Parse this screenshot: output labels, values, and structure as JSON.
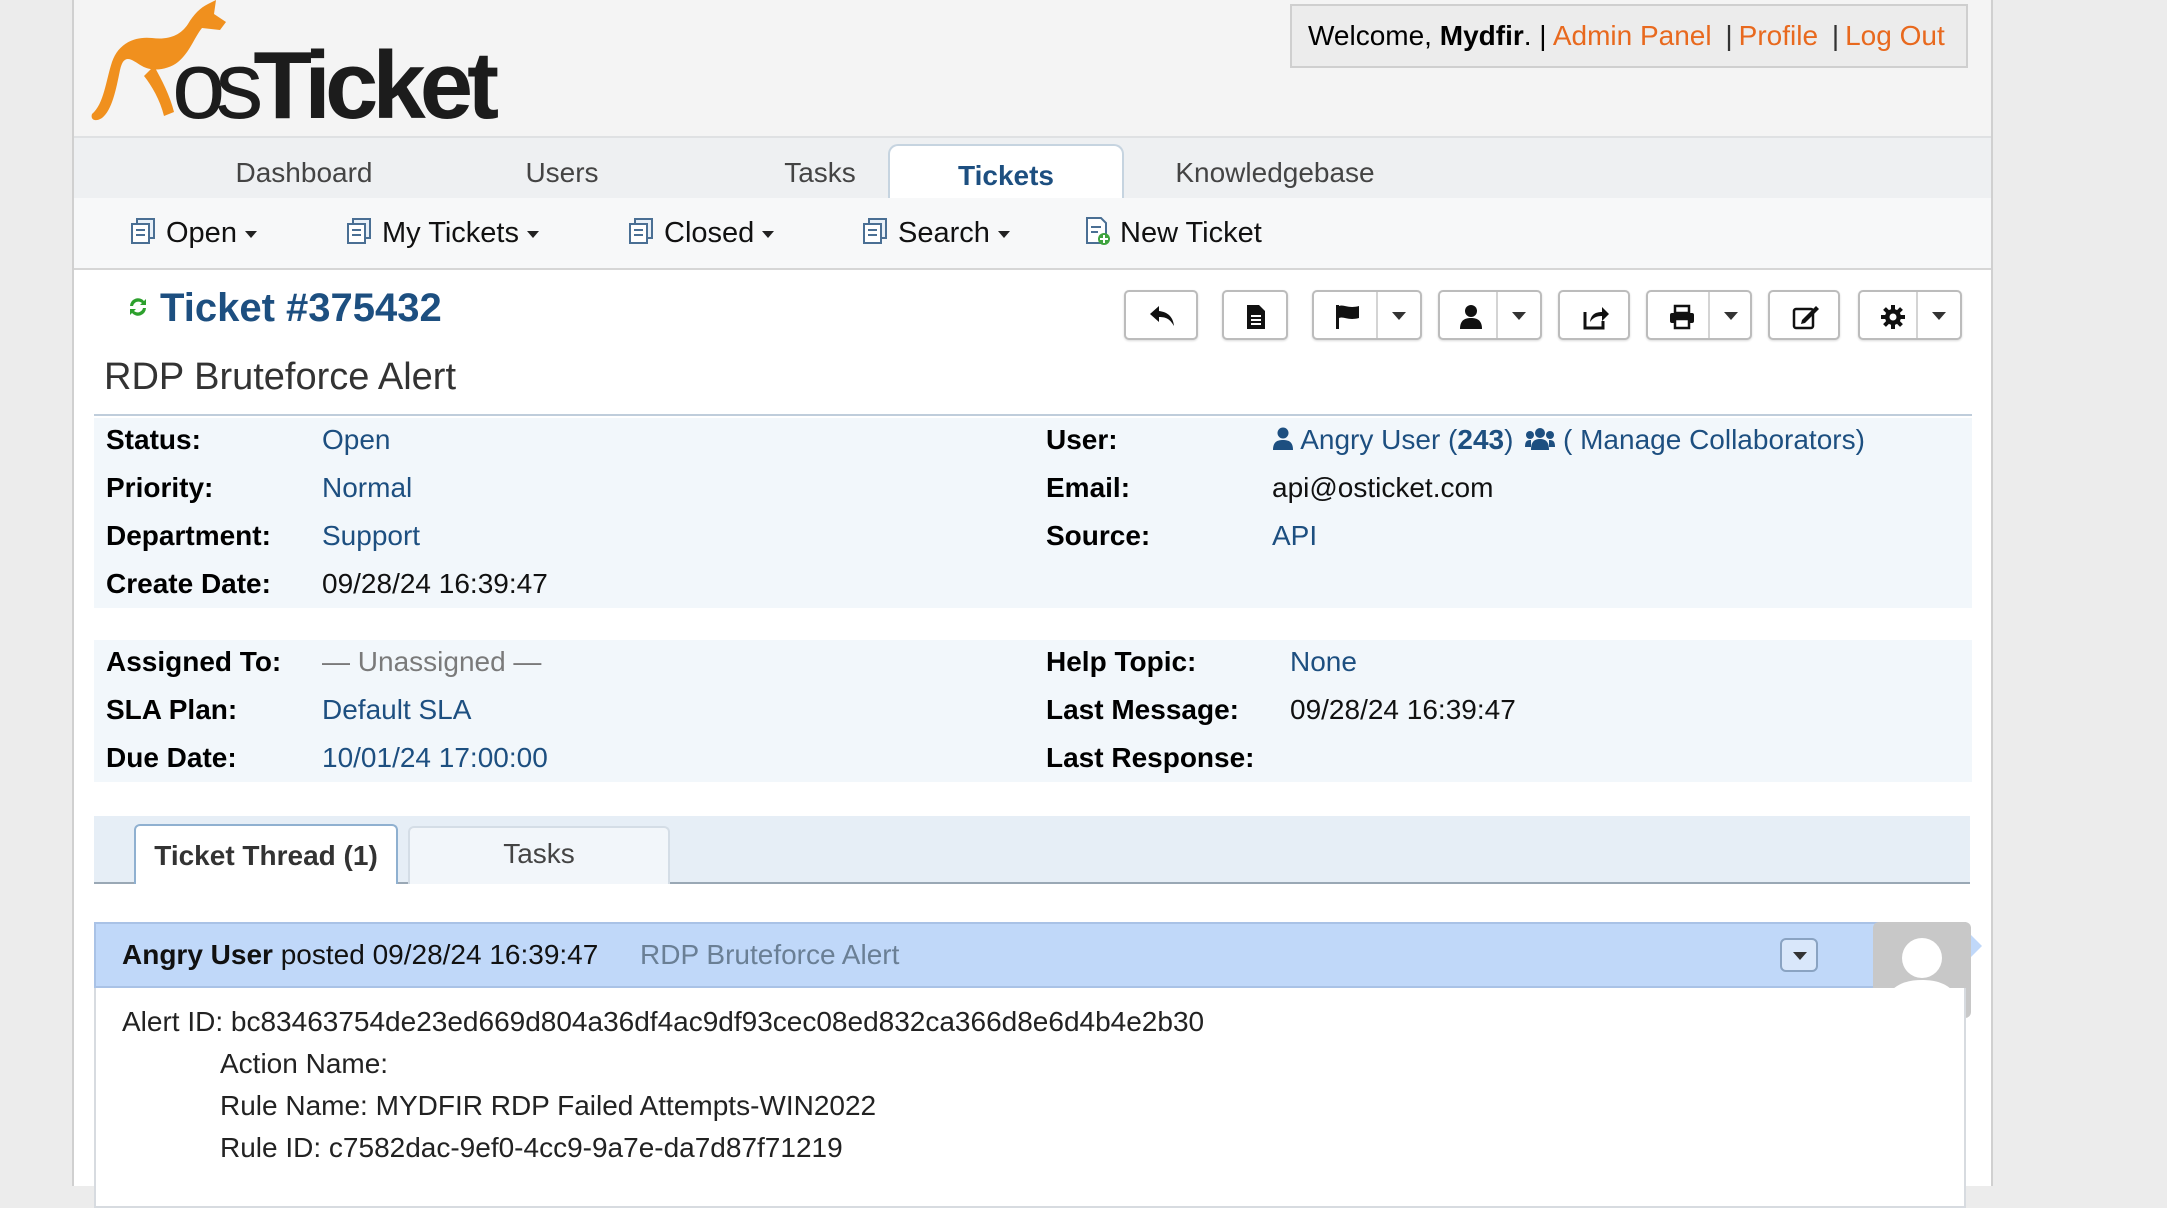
{
  "header": {
    "logo_text_os": "os",
    "logo_text_ticket": "Ticket",
    "welcome_prefix": "Welcome, ",
    "username": "Mydfir",
    "welcome_suffix": ". |",
    "admin_panel": "Admin Panel",
    "profile": "Profile",
    "logout": "Log Out",
    "separator": "|"
  },
  "nav": {
    "tabs": [
      {
        "label": "Dashboard"
      },
      {
        "label": "Users"
      },
      {
        "label": "Tasks"
      },
      {
        "label": "Tickets"
      },
      {
        "label": "Knowledgebase"
      }
    ],
    "active_tab": "Tickets"
  },
  "subnav": {
    "items": [
      {
        "label": "Open"
      },
      {
        "label": "My Tickets"
      },
      {
        "label": "Closed"
      },
      {
        "label": "Search"
      },
      {
        "label": "New Ticket"
      }
    ]
  },
  "ticket": {
    "title": "Ticket #375432",
    "subject": "RDP Bruteforce Alert",
    "details_left": [
      {
        "label": "Status:",
        "value": "Open"
      },
      {
        "label": "Priority:",
        "value": "Normal"
      },
      {
        "label": "Department:",
        "value": "Support"
      },
      {
        "label": "Create Date:",
        "value": "09/28/24 16:39:47"
      }
    ],
    "user_label": "User:",
    "user_name": "Angry User",
    "user_count": "243",
    "manage_collaborators": "( Manage Collaborators)",
    "email_label": "Email:",
    "email_value": "api@osticket.com",
    "source_label": "Source:",
    "source_value": "API",
    "assignment_left": [
      {
        "label": "Assigned To:",
        "value": "— Unassigned —"
      },
      {
        "label": "SLA Plan:",
        "value": "Default SLA"
      },
      {
        "label": "Due Date:",
        "value": "10/01/24 17:00:00"
      }
    ],
    "assignment_right": [
      {
        "label": "Help Topic:",
        "value": "None"
      },
      {
        "label": "Last Message:",
        "value": "09/28/24 16:39:47"
      },
      {
        "label": "Last Response:",
        "value": ""
      }
    ]
  },
  "thread_tabs": [
    {
      "label": "Ticket Thread (1)"
    },
    {
      "label": "Tasks"
    }
  ],
  "entry": {
    "author": "Angry User",
    "posted": "posted 09/28/24 16:39:47",
    "title": "RDP Bruteforce Alert",
    "lines": [
      "Alert ID: bc83463754de23ed669d804a36df4ac9df93cec08ed832ca366d8e6d4b4e2b30",
      "Action Name:",
      "Rule Name: MYDFIR RDP Failed Attempts-WIN2022",
      "Rule ID: c7582dac-9ef0-4cc9-9a7e-da7d87f71219"
    ]
  },
  "colors": {
    "brand_orange": "#e8691e",
    "link_blue": "#1d4f80",
    "entry_header": "#c0d8f9"
  }
}
